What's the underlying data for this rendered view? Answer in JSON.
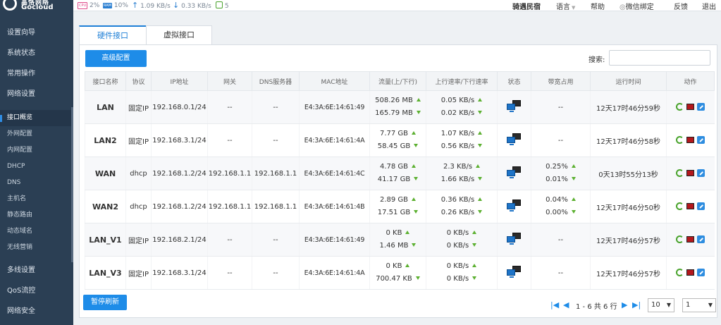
{
  "header": {
    "logo_cn": "高恪网络",
    "logo_en": "Gocloud",
    "cpu_badge": "CPU",
    "cpu": "2%",
    "ram_badge": "RAM",
    "ram": "10%",
    "upload": "1.09 KB/s",
    "download": "0.33 KB/s",
    "users": "5",
    "links": {
      "hostel": "骑遇民宿",
      "language": "语言",
      "help": "帮助",
      "wechat": "微信绑定",
      "feedback": "反馈",
      "logout": "退出"
    }
  },
  "sidebar": {
    "items": [
      {
        "label": "设置向导"
      },
      {
        "label": "系统状态"
      },
      {
        "label": "常用操作"
      },
      {
        "label": "网络设置"
      },
      {
        "label": "接口概览"
      },
      {
        "label": "外网配置"
      },
      {
        "label": "内网配置"
      },
      {
        "label": "DHCP"
      },
      {
        "label": "DNS"
      },
      {
        "label": "主机名"
      },
      {
        "label": "静态路由"
      },
      {
        "label": "动态域名"
      },
      {
        "label": "无线营销"
      },
      {
        "label": "多线设置"
      },
      {
        "label": "QoS流控"
      },
      {
        "label": "网络安全"
      }
    ]
  },
  "tabs": [
    {
      "label": "硬件接口"
    },
    {
      "label": "虚拟接口"
    }
  ],
  "toolbar": {
    "advanced_button": "高级配置",
    "search_label": "搜索:",
    "search_value": ""
  },
  "table": {
    "columns": [
      "接口名称",
      "协议",
      "IP地址",
      "网关",
      "DNS服务器",
      "MAC地址",
      "流量(上/下行)",
      "上行速率/下行速率",
      "状态",
      "带宽占用",
      "运行时间",
      "动作"
    ],
    "rows": [
      {
        "name": "LAN",
        "protocol": "固定IP",
        "ip": "192.168.0.1/24",
        "gateway": "--",
        "dns": "--",
        "mac": "E4:3A:6E:14:61:49",
        "traffic_up": "508.26 MB",
        "traffic_down": "165.79 MB",
        "rate_up": "0.05 KB/s",
        "rate_down": "0.02 KB/s",
        "bw_up": "--",
        "bw_down": "",
        "uptime": "12天17时46分59秒"
      },
      {
        "name": "LAN2",
        "protocol": "固定IP",
        "ip": "192.168.3.1/24",
        "gateway": "--",
        "dns": "--",
        "mac": "E4:3A:6E:14:61:4A",
        "traffic_up": "7.77 GB",
        "traffic_down": "58.45 GB",
        "rate_up": "1.07 KB/s",
        "rate_down": "0.56 KB/s",
        "bw_up": "--",
        "bw_down": "",
        "uptime": "12天17时46分58秒"
      },
      {
        "name": "WAN",
        "protocol": "dhcp",
        "ip": "192.168.1.2/24",
        "gateway": "192.168.1.1",
        "dns": "192.168.1.1",
        "mac": "E4:3A:6E:14:61:4C",
        "traffic_up": "4.78 GB",
        "traffic_down": "41.17 GB",
        "rate_up": "2.3 KB/s",
        "rate_down": "1.66 KB/s",
        "bw_up": "0.25%",
        "bw_down": "0.01%",
        "uptime": "0天13时55分13秒"
      },
      {
        "name": "WAN2",
        "protocol": "dhcp",
        "ip": "192.168.1.2/24",
        "gateway": "192.168.1.1",
        "dns": "192.168.1.1",
        "mac": "E4:3A:6E:14:61:4B",
        "traffic_up": "2.89 GB",
        "traffic_down": "17.51 GB",
        "rate_up": "0.36 KB/s",
        "rate_down": "0.26 KB/s",
        "bw_up": "0.04%",
        "bw_down": "0.00%",
        "uptime": "12天17时46分50秒"
      },
      {
        "name": "LAN_V1",
        "protocol": "固定IP",
        "ip": "192.168.2.1/24",
        "gateway": "--",
        "dns": "--",
        "mac": "E4:3A:6E:14:61:49",
        "traffic_up": "0 KB",
        "traffic_down": "1.46 MB",
        "rate_up": "0 KB/s",
        "rate_down": "0 KB/s",
        "bw_up": "--",
        "bw_down": "",
        "uptime": "12天17时46分57秒"
      },
      {
        "name": "LAN_V3",
        "protocol": "固定IP",
        "ip": "192.168.3.1/24",
        "gateway": "--",
        "dns": "--",
        "mac": "E4:3A:6E:14:61:4A",
        "traffic_up": "0 KB",
        "traffic_down": "700.47 KB",
        "rate_up": "0 KB/s",
        "rate_down": "0 KB/s",
        "bw_up": "--",
        "bw_down": "",
        "uptime": "12天17时46分57秒"
      }
    ]
  },
  "footer": {
    "pause_button": "暂停刷新",
    "pagination": "1 - 6 共 6 行",
    "page_size": "10",
    "page": "1"
  },
  "colors": {
    "accent": "#1e8ce8",
    "sidebar": "#2b3f54",
    "arrow_green": "#5cb030"
  }
}
